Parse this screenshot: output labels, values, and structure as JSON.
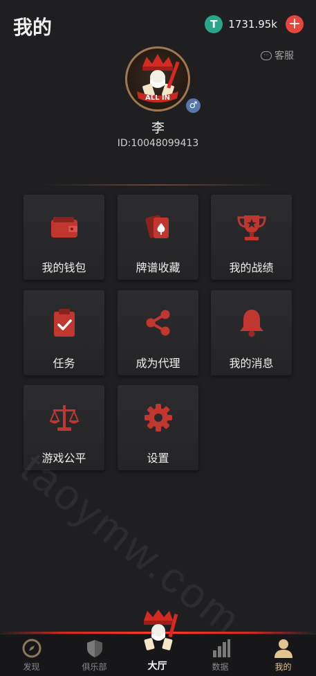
{
  "header": {
    "title": "我的",
    "balance": "1731.95k",
    "tether_symbol": "T",
    "add_symbol": "+"
  },
  "support": {
    "label": "客服",
    "icon_glyph": "···"
  },
  "profile": {
    "avatar_text": "ALL IN",
    "gender_glyph": "♂",
    "name": "李",
    "id": "ID:10048099413"
  },
  "menu": {
    "wallet": "我的钱包",
    "collection": "牌谱收藏",
    "record": "我的战绩",
    "tasks": "任务",
    "agent": "成为代理",
    "messages": "我的消息",
    "fairness": "游戏公平",
    "settings": "设置"
  },
  "watermark": "taoymw.com",
  "tabbar": {
    "discover": "发现",
    "club": "俱乐部",
    "hall": "大厅",
    "data": "数据",
    "mine": "我的"
  },
  "colors": {
    "accent_red": "#d8403a",
    "active_tab": "#e2c48e",
    "background": "#1f1f21"
  }
}
